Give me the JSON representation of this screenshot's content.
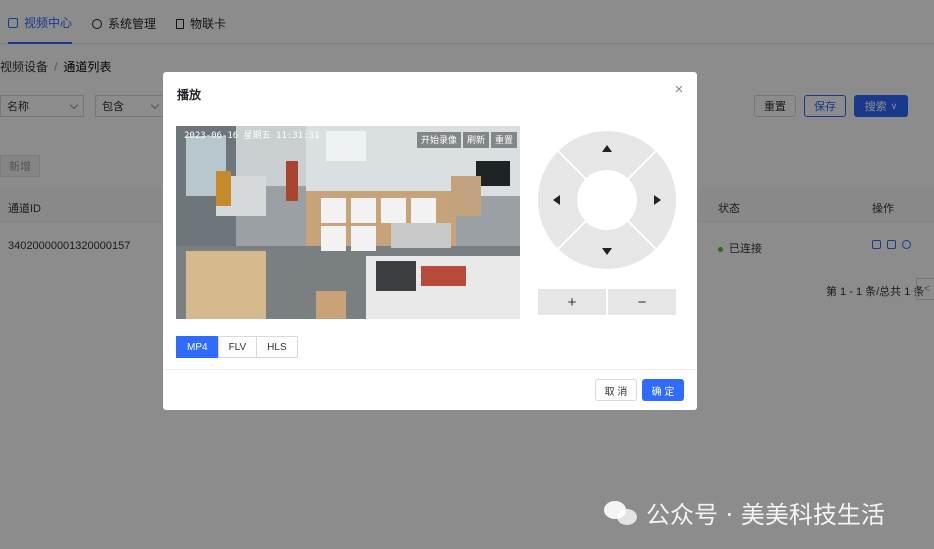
{
  "nav": {
    "tabs": [
      {
        "label": "视频中心",
        "icon": "play-icon",
        "active": true
      },
      {
        "label": "系统管理",
        "icon": "settings-icon",
        "active": false
      },
      {
        "label": "物联卡",
        "icon": "sim-card-icon",
        "active": false
      }
    ]
  },
  "breadcrumb": {
    "parent": "视频设备",
    "separator": "/",
    "current": "通道列表"
  },
  "filters": {
    "field": "名称",
    "operator": "包含"
  },
  "toolbar": {
    "reset": "重置",
    "save": "保存",
    "search": "搜索"
  },
  "new_button": "新增",
  "table": {
    "columns": {
      "id": "通道ID",
      "status": "状态",
      "actions": "操作"
    },
    "rows": [
      {
        "id": "34020000001320000157",
        "status": "已连接"
      }
    ]
  },
  "pagination": {
    "summary": "第 1 - 1 条/总共 1 条",
    "prev": "<"
  },
  "modal": {
    "title": "播放",
    "close": "×",
    "video": {
      "osd": "2023-06-16  星期五  11:31:31",
      "buttons": [
        "开始录像",
        "刷新",
        "重置"
      ]
    },
    "formats": [
      "MP4",
      "FLV",
      "HLS"
    ],
    "active_format": "MP4",
    "ptz": {
      "zoom_in": "+",
      "zoom_out": "−"
    },
    "cancel": "取 消",
    "ok": "确 定"
  },
  "watermark": "公众号 · 美美科技生活",
  "colors": {
    "accent": "#2f6bff",
    "status_ok": "#52c41a",
    "overlay": "rgba(0,0,0,0.45)"
  }
}
